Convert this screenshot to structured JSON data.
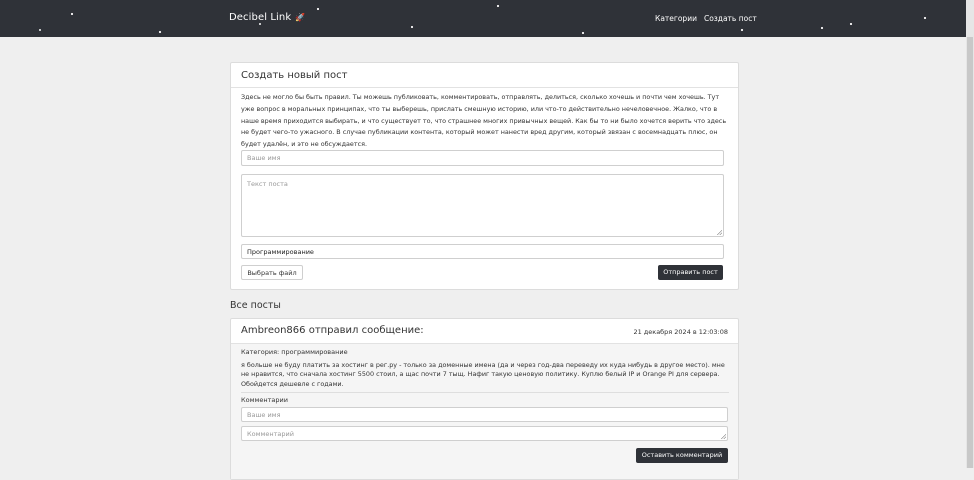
{
  "navbar": {
    "brand": "Decibel Link",
    "links": [
      "Категории",
      "Создать пост"
    ]
  },
  "create_post": {
    "title": "Создать новый пост",
    "description": "Здесь не могло бы быть правил. Ты можешь публиковать, комментировать, отправлять, делиться, сколько хочешь и почти чем хочешь. Тут уже вопрос в моральных принципах, что ты выберешь, прислать смешную историю, или что-то действительно нечеловечное. Жалко, что в наше время приходится выбирать, и что существует то, что страшнее многих привычных вещей. Как бы то ни было хочется верить что здесь не будет чего-то ужасного. В случае публикации контента, который может нанести вред другим, который звязан с восемнадцать плюс, он будет удалён, и это не обсуждается.",
    "name_placeholder": "Ваше имя",
    "text_placeholder": "Текст поста",
    "category_value": "Программирование",
    "choose_file_label": "Выбрать файл",
    "submit_label": "Отправить пост"
  },
  "posts_section": {
    "title": "Все посты"
  },
  "post": {
    "author_line": "Ambreon866 отправил сообщение:",
    "date": "21 декабря 2024 в 12:03:08",
    "category": "Категория: программирование",
    "text": "я больше не буду платить за хостинг в рег.ру - только за доменные имена (да и через год-два переведу их куда нибудь в другое место). мне не нравится, что сначала хостинг 5500 стоил, а щас почти 7 тыщ. Нафиг такую ценовую политику. Куплю белый IP и Orange PI для сервера. Обойдется дешевле с годами.",
    "comments_label": "Комментарии",
    "comment_name_placeholder": "Ваше имя",
    "comment_placeholder": "Комментарий",
    "comment_button_label": "Оставить комментарий"
  },
  "colors": {
    "navbar_bg": "#2f3238",
    "page_bg": "#efefef",
    "button_dark": "#2f3238"
  }
}
